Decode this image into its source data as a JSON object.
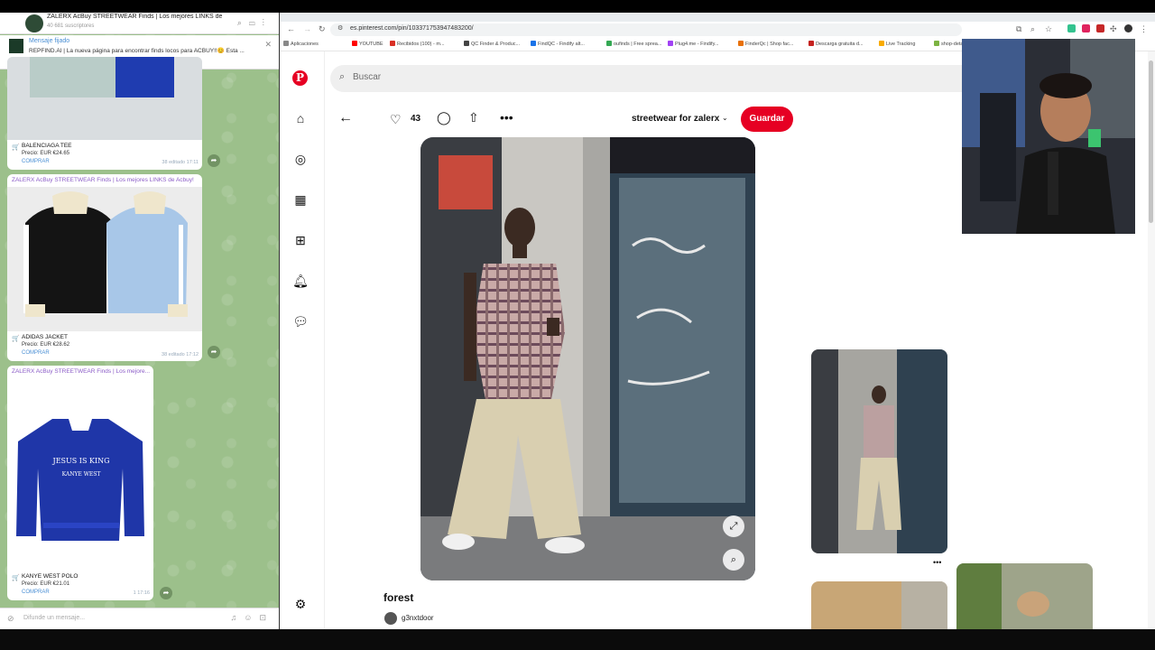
{
  "telegram": {
    "channel_title": "ZALERX AcBuy STREETWEAR Finds | Los mejores LINKS de AcBuy!",
    "subscribers": "40 681 suscriptores",
    "pinned_label": "Mensaje fijado",
    "pinned_text": "REPFIND.AI | La nueva página para encontrar finds locos para ACBUY!!😊 Esta ...",
    "messages": [
      {
        "author": "",
        "name": "BALENCIAGA TEE",
        "price": "Precio: EUR €24.65",
        "buy": "COMPRAR",
        "meta": "38  editado 17:11"
      },
      {
        "author": "ZALERX AcBuy STREETWEAR Finds | Los mejores LINKS de Acbuy!",
        "name": "ADIDAS JACKET",
        "price": "Precio: EUR €28.62",
        "buy": "COMPRAR",
        "meta": "38  editado 17:12"
      },
      {
        "author": "ZALERX AcBuy STREETWEAR Finds | Los mejore...",
        "name": "KANYE WEST POLO",
        "price": "Precio: EUR €21.01",
        "buy": "COMPRAR",
        "meta": "1  17:16",
        "jersey_text_1": "JESUS IS KING",
        "jersey_text_2": "KANYE WEST"
      }
    ],
    "input_placeholder": "Difunde un mensaje..."
  },
  "browser": {
    "url": "es.pinterest.com/pin/103371753947483200/",
    "bookmarks": [
      {
        "label": "Aplicaciones",
        "color": "#888888"
      },
      {
        "label": "YOUTUBE",
        "color": "#ff0000"
      },
      {
        "label": "Recibidos (100) - m...",
        "color": "#d93025"
      },
      {
        "label": "QC Finder & Produc...",
        "color": "#444444"
      },
      {
        "label": "FindQC - Findify alt...",
        "color": "#1a73e8"
      },
      {
        "label": "oufinds | Free sprea...",
        "color": "#34a853"
      },
      {
        "label": "Plug4.me - Findify...",
        "color": "#a142f4"
      },
      {
        "label": "FinderQc | Shop fac...",
        "color": "#e8710a"
      },
      {
        "label": "Descarga gratuita d...",
        "color": "#c5221f"
      },
      {
        "label": "Live Tracking",
        "color": "#f9ab00"
      },
      {
        "label": "shop-deta...",
        "color": "#7cb342"
      }
    ]
  },
  "pinterest": {
    "search_placeholder": "Buscar",
    "likes": "43",
    "board": "streetwear for zalerx",
    "save_label": "Guardar",
    "pin_title": "forest",
    "username": "g3nxtdoor",
    "accent": "#e60023",
    "sidebar_icons": [
      "home-icon",
      "explore-icon",
      "boards-icon",
      "create-icon",
      "notifications-icon",
      "messages-icon",
      "settings-icon"
    ]
  }
}
